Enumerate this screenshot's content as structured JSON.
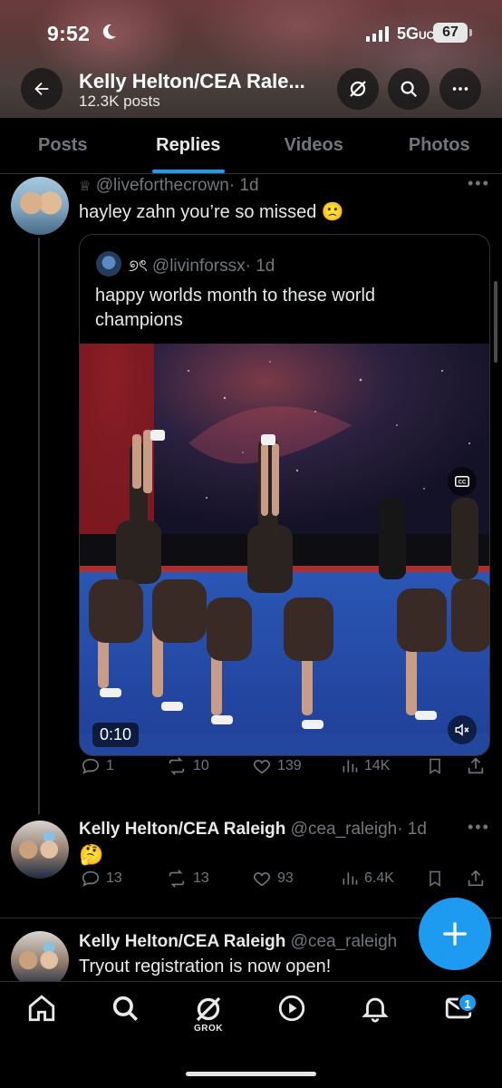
{
  "status_bar": {
    "time": "9:52",
    "network": "5G",
    "network_suffix": "UC",
    "battery": "67"
  },
  "header": {
    "title": "Kelly Helton/CEA Rale...",
    "posts_count": "12.3K posts"
  },
  "tabs": [
    {
      "label": "Posts",
      "active": false
    },
    {
      "label": "Replies",
      "active": true
    },
    {
      "label": "Videos",
      "active": false
    },
    {
      "label": "Photos",
      "active": false
    }
  ],
  "posts": [
    {
      "handle": "@liveforthecrown",
      "time": "· 1d",
      "text": "hayley zahn you’re so missed 🙁",
      "quote": {
        "name_glyph": "୭ৎ",
        "handle": "@livinforssx",
        "time": "· 1d",
        "text": "happy worlds month to these world champions",
        "video_time": "0:10"
      },
      "stats": {
        "replies": "1",
        "reposts": "10",
        "likes": "139",
        "views": "14K"
      }
    },
    {
      "name": "Kelly Helton/CEA Raleigh",
      "handle": "@cea_raleigh",
      "time": "· 1d",
      "text": "🤔",
      "stats": {
        "replies": "13",
        "reposts": "13",
        "likes": "93",
        "views": "6.4K"
      }
    },
    {
      "name": "Kelly Helton/CEA Raleigh",
      "handle": "@cea_raleigh",
      "text": "Tryout registration is now open!"
    }
  ],
  "bottom_nav": {
    "grok_label": "GROK",
    "messages_badge": "1"
  },
  "colors": {
    "accent": "#1d9bf0",
    "background": "#000000",
    "muted": "#71767b",
    "text": "#e7e9ea"
  }
}
